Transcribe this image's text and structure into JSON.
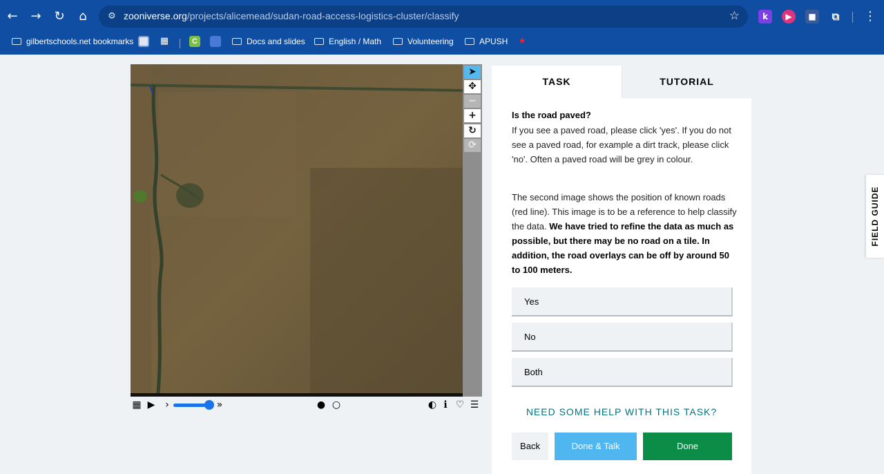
{
  "browser": {
    "url_host": "zooniverse.org",
    "url_path": "/projects/alicemead/sudan-road-access-logistics-cluster/classify",
    "nav": {
      "back": "←",
      "forward": "→",
      "reload": "↻",
      "home": "⌂"
    },
    "extensions": [
      {
        "name": "k-extension-icon",
        "glyph": "k",
        "color": "#7b3fe4"
      },
      {
        "name": "record-extension-icon",
        "glyph": "▶",
        "color": "#e0337d"
      },
      {
        "name": "screencast-extension-icon",
        "glyph": "■",
        "color": "#3a5a9a"
      }
    ],
    "bookmarks": {
      "gilbert": "gilbertschools.net bookmarks",
      "docs": "Docs and slides",
      "english": "English / Math",
      "volunteering": "Volunteering",
      "apush": "APUSH"
    }
  },
  "viewer": {
    "tools": {
      "select": "➤",
      "move": "✥",
      "zoom_out": "−",
      "zoom_in": "+",
      "rotate": "↻",
      "reset": "⟳"
    },
    "controls": {
      "grid": "▦",
      "play": "▶",
      "prev": "›",
      "next": "»",
      "frame_active": "●",
      "frame_inactive": "○",
      "contrast": "◐",
      "info": "ℹ",
      "favorite": "♡",
      "collections": "☰"
    },
    "slider_value": 0.9
  },
  "panel": {
    "tab_task": "TASK",
    "tab_tutorial": "TUTORIAL",
    "question_title": "Is the road paved?",
    "question_text": "If you see a paved road, please click 'yes'. If you do not see a paved road, for example a dirt track, please click 'no'. Often a paved road will be grey in colour.",
    "note_intro": "The second image shows the position of known roads (red line). This image is to be a reference to help classify the data. ",
    "note_bold": "We have tried to refine the data as much as possible, but there may be no road on a tile. In addition, the road overlays can be off by around 50 to 100 meters.",
    "answers": [
      "Yes",
      "No",
      "Both"
    ],
    "help_link": "NEED SOME HELP WITH THIS TASK?",
    "back_button": "Back",
    "done_talk_button": "Done & Talk",
    "done_button": "Done"
  },
  "field_guide": "FIELD GUIDE",
  "colors": {
    "chrome": "#0f4ea3",
    "done": "#0b8d47",
    "done_talk": "#4fb6f0",
    "help_link": "#00747f",
    "active_tool": "#55b8ee"
  }
}
